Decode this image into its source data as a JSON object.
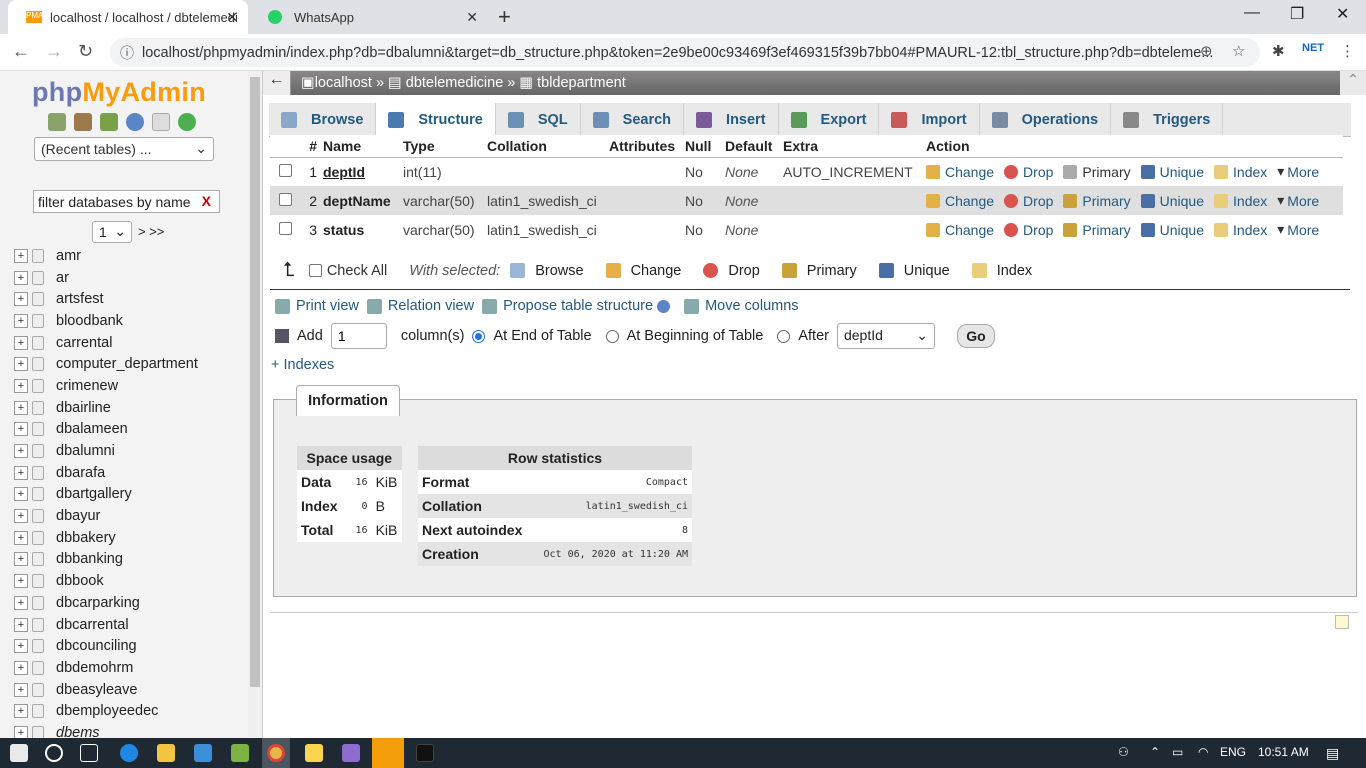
{
  "browser": {
    "tabs": [
      {
        "title": "localhost / localhost / dbtelemedi",
        "active": true
      },
      {
        "title": "WhatsApp",
        "active": false
      }
    ],
    "url": "localhost/phpmyadmin/index.php?db=dbalumni&target=db_structure.php&token=2e9be00c93469f3ef469315f39b7bb04#PMAURL-12:tbl_structure.php?db=dbteleme..."
  },
  "sidebar": {
    "logo_part1": "php",
    "logo_part2": "MyAdmin",
    "recent": "(Recent tables) ...",
    "filter_placeholder": "filter databases by name",
    "filter_clear": "X",
    "page": "1",
    "page_next": "> >>",
    "databases": [
      "amr",
      "ar",
      "artsfest",
      "bloodbank",
      "carrental",
      "computer_department",
      "crimenew",
      "dbairline",
      "dbalameen",
      "dbalumni",
      "dbarafa",
      "dbartgallery",
      "dbayur",
      "dbbakery",
      "dbbanking",
      "dbbook",
      "dbcarparking",
      "dbcarrental",
      "dbcounciling",
      "dbdemohrm",
      "dbeasyleave",
      "dbemployeedec",
      "dbems"
    ]
  },
  "breadcrumb": {
    "server": "localhost",
    "database": "dbtelemedicine",
    "table": "tbldepartment",
    "sep": "»"
  },
  "tabs": [
    "Browse",
    "Structure",
    "SQL",
    "Search",
    "Insert",
    "Export",
    "Import",
    "Operations",
    "Triggers"
  ],
  "columns_header": [
    "#",
    "Name",
    "Type",
    "Collation",
    "Attributes",
    "Null",
    "Default",
    "Extra",
    "Action"
  ],
  "columns": [
    {
      "num": "1",
      "name": "deptId",
      "type": "int(11)",
      "collation": "",
      "attributes": "",
      "null": "No",
      "default": "None",
      "extra": "AUTO_INCREMENT"
    },
    {
      "num": "2",
      "name": "deptName",
      "type": "varchar(50)",
      "collation": "latin1_swedish_ci",
      "attributes": "",
      "null": "No",
      "default": "None",
      "extra": ""
    },
    {
      "num": "3",
      "name": "status",
      "type": "varchar(50)",
      "collation": "latin1_swedish_ci",
      "attributes": "",
      "null": "No",
      "default": "None",
      "extra": ""
    }
  ],
  "row_actions": [
    "Change",
    "Drop",
    "Primary",
    "Unique",
    "Index",
    "More"
  ],
  "with_selected": {
    "check_all": "Check All",
    "label": "With selected:",
    "items": [
      "Browse",
      "Change",
      "Drop",
      "Primary",
      "Unique",
      "Index"
    ]
  },
  "links": [
    "Print view",
    "Relation view",
    "Propose table structure",
    "Move columns"
  ],
  "add_row": {
    "add": "Add",
    "count": "1",
    "columns": "column(s)",
    "end": "At End of Table",
    "beginning": "At Beginning of Table",
    "after": "After",
    "after_field": "deptId",
    "go": "Go"
  },
  "indexes_link": "+ Indexes",
  "information": {
    "title": "Information",
    "space_header": "Space usage",
    "space": [
      {
        "label": "Data",
        "value": "16",
        "unit": "KiB"
      },
      {
        "label": "Index",
        "value": "0",
        "unit": "B"
      },
      {
        "label": "Total",
        "value": "16",
        "unit": "KiB"
      }
    ],
    "row_header": "Row statistics",
    "rows": [
      {
        "label": "Format",
        "value": "Compact"
      },
      {
        "label": "Collation",
        "value": "latin1_swedish_ci"
      },
      {
        "label": "Next autoindex",
        "value": "8"
      },
      {
        "label": "Creation",
        "value": "Oct 06, 2020 at 11:20 AM"
      }
    ]
  },
  "taskbar": {
    "lang": "ENG",
    "time": "10:51 AM"
  }
}
